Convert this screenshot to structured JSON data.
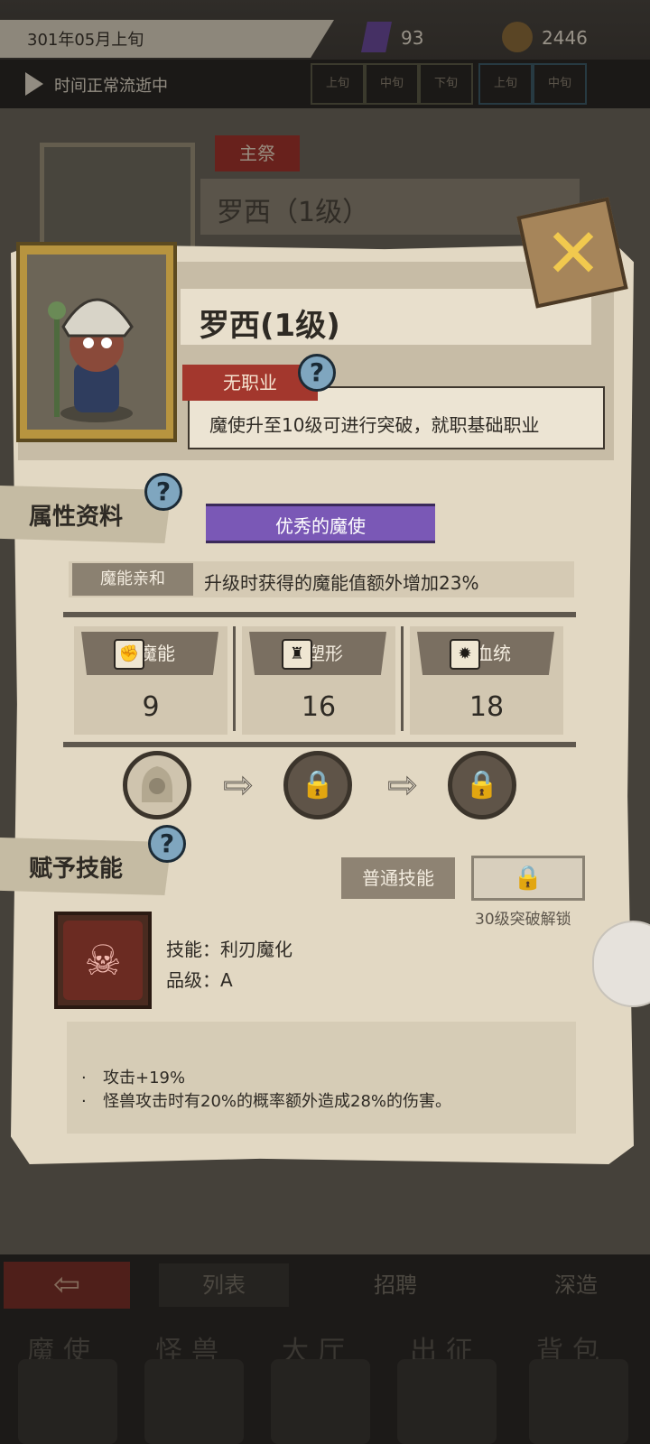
{
  "top_bar": {
    "date": "301年05月上旬",
    "crystal_count": "93",
    "coin_count": "2446",
    "time_status": "时间正常流逝中",
    "segments": [
      "上旬",
      "中旬",
      "下旬",
      "上旬",
      "中旬"
    ]
  },
  "background": {
    "role_tag": "主祭",
    "name_plate": "罗西（1级）"
  },
  "hero": {
    "name": "罗西(1级)",
    "job_tag": "无职业",
    "job_desc": "魔使升至10级可进行突破，就职基础职业"
  },
  "attributes": {
    "section_title": "属性资料",
    "quality": "优秀的魔使",
    "trait_label": "魔能亲和",
    "trait_desc": "升级时获得的魔能值额外增加23%",
    "stats": [
      {
        "label": "魔能",
        "value": "9",
        "icon": "magic-fist-icon"
      },
      {
        "label": "塑形",
        "value": "16",
        "icon": "body-shape-icon"
      },
      {
        "label": "血统",
        "value": "18",
        "icon": "bloodline-icon"
      }
    ],
    "evolution_arrows": [
      "⇨",
      "⇨"
    ],
    "lock_glyph": "🔒"
  },
  "skills": {
    "section_title": "赋予技能",
    "normal_button": "普通技能",
    "locked_glyph": "🔒",
    "unlock_hint": "30级突破解锁",
    "skill_name": "技能：利刃魔化",
    "skill_grade": "品级：A",
    "effects": [
      "攻击+19%",
      "怪兽攻击时有20%的概率额外造成28%的伤害。"
    ],
    "bullet": "·"
  },
  "bottom_nav": {
    "sub_tabs": [
      "列表",
      "招聘",
      "深造"
    ],
    "main_tabs": [
      "魔使",
      "怪兽",
      "大厅",
      "出征",
      "背包"
    ]
  },
  "colors": {
    "accent_red": "#a3372d",
    "quality_purple": "#7a58b6",
    "help_blue": "#7fa6bf",
    "close_gold": "#f1c94e"
  }
}
